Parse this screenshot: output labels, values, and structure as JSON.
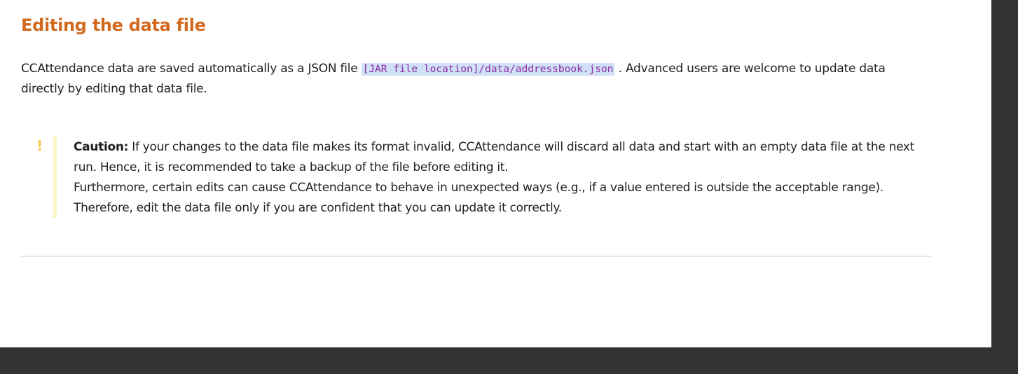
{
  "section": {
    "heading": "Editing the data file",
    "paragraph": {
      "before": "CCAttendance data are saved automatically as a JSON file ",
      "code": "[JAR file location]/data/addressbook.json",
      "after": " . Advanced users are welcome to update data directly by editing that data file."
    }
  },
  "callout": {
    "icon": "!",
    "icon_name": "exclamation-icon",
    "label": "Caution:",
    "line1": " If your changes to the data file makes its format invalid, CCAttendance will discard all data and start with an empty data file at the next run. Hence, it is recommended to take a backup of the file before editing it.",
    "line2": "Furthermore, certain edits can cause CCAttendance to behave in unexpected ways (e.g., if a value entered is outside the acceptable range). Therefore, edit the data file only if you are confident that you can update it correctly.",
    "colors": {
      "icon": "#f2c94c",
      "bar": "#fdf3c4"
    }
  },
  "colors": {
    "heading": "#d2691e",
    "code_text": "#8e2aa3",
    "code_highlight": "#cfe0f7",
    "background": "#333333"
  }
}
